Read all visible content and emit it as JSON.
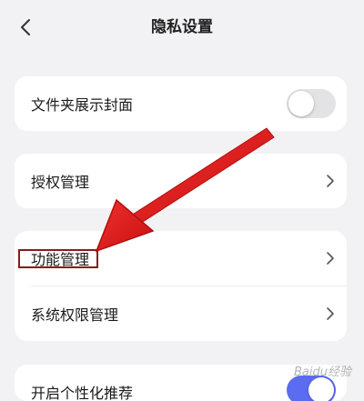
{
  "header": {
    "title": "隐私设置"
  },
  "settings": {
    "folder_cover": {
      "label": "文件夹展示封面",
      "enabled": false
    },
    "authorization": {
      "label": "授权管理"
    },
    "feature_management": {
      "label": "功能管理"
    },
    "system_permissions": {
      "label": "系统权限管理"
    },
    "personalized_recommend": {
      "label": "开启个性化推荐",
      "enabled": true
    }
  },
  "colors": {
    "toggle_on": "#5b6cf0",
    "toggle_off": "#e3e3e6",
    "annotation_arrow": "#e31b1b",
    "annotation_box": "#8b1a1a"
  },
  "watermark": "Baidu经验"
}
